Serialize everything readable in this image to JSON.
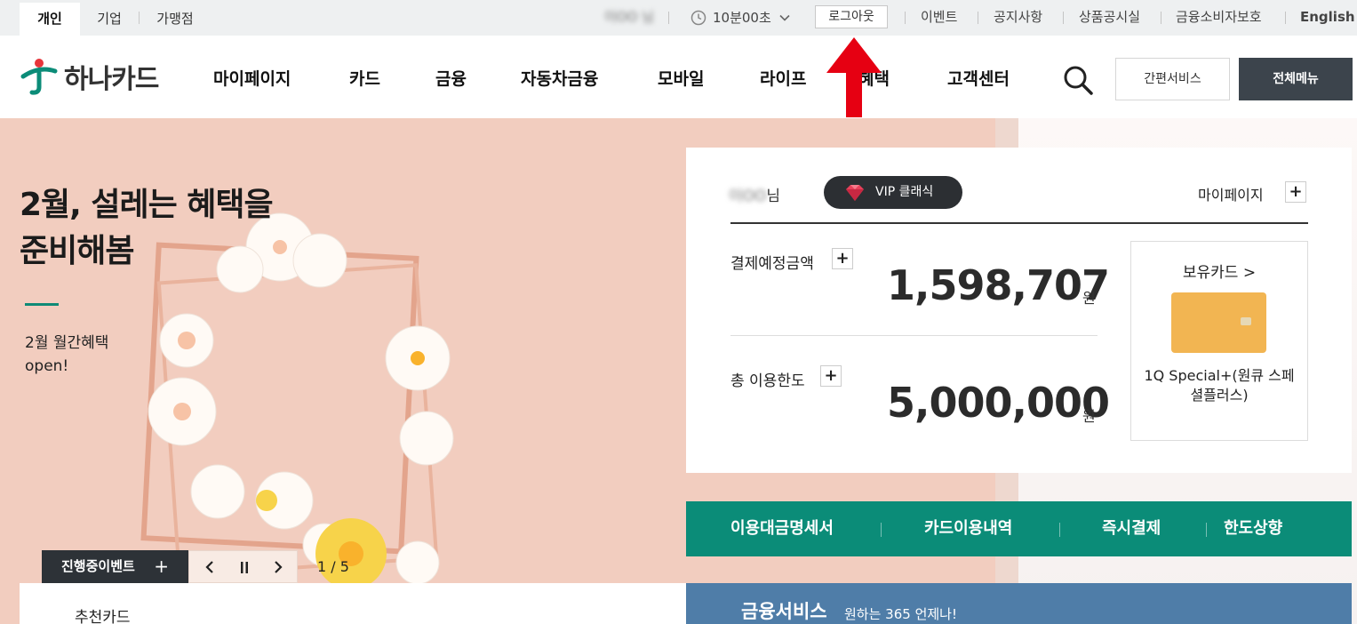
{
  "util": {
    "segments": [
      "개인",
      "기업",
      "가맹점"
    ],
    "user_masked": "이OO 님",
    "timer": "10분00초",
    "logout": "로그아웃",
    "links": [
      "이벤트",
      "공지사항",
      "상품공시실",
      "금융소비자보호",
      "English"
    ]
  },
  "header": {
    "logo": "하나카드",
    "nav": [
      "마이페이지",
      "카드",
      "금융",
      "자동차금융",
      "모바일",
      "라이프",
      "혜택",
      "고객센터"
    ],
    "simple_service": "간편서비스",
    "all_menu": "전체메뉴"
  },
  "banner": {
    "title_line1": "2월, 설레는 혜택을",
    "title_line2": "준비해봄",
    "sub_line1": "2월 월간혜택",
    "sub_line2": "open!",
    "event_label": "진행중이벤트",
    "page": "1 / 5"
  },
  "panel": {
    "user_name": "이OO",
    "honorific": "님",
    "vip": "VIP 클래식",
    "mypage": "마이페이지",
    "payment_label": "결제예정금액",
    "payment_value": "1,598,707",
    "limit_label": "총 이용한도",
    "limit_value": "5,000,000",
    "unit": "원",
    "cards_title": "보유카드 >",
    "card_name": "1Q Special+(원큐 스페셜플러스)"
  },
  "quick": [
    "이용대금명세서",
    "카드이용내역",
    "즉시결제",
    "한도상향"
  ],
  "recommend": "추천카드",
  "finance": {
    "title": "금융서비스",
    "sub": "원하는 365 언제나!"
  },
  "colors": {
    "brand_green": "#0b8c78",
    "dark_button": "#3c444c",
    "banner_bg": "#f2cdbf",
    "finance_blue": "#4f7da8",
    "arrow_red": "#e60012"
  }
}
